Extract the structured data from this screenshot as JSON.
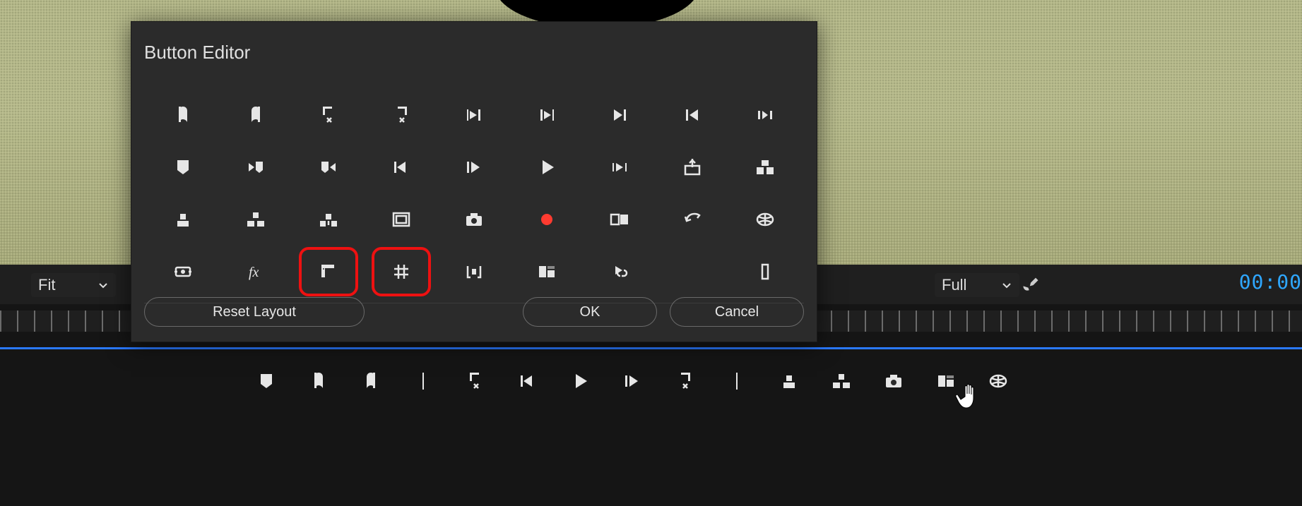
{
  "dialog": {
    "title": "Button Editor",
    "reset_label": "Reset Layout",
    "ok_label": "OK",
    "cancel_label": "Cancel",
    "icons": [
      [
        "mark-in",
        "mark-out",
        "go-to-in",
        "go-to-out",
        "step-back-in",
        "step-forward-out",
        "step-to-next",
        "go-to-previous",
        "play-around"
      ],
      [
        "add-marker",
        "next-marker",
        "prev-marker",
        "step-back-1-frame",
        "step-forward-1-frame",
        "play",
        "play-in-to-out",
        "export-frame",
        "multicam-view"
      ],
      [
        "lift",
        "extract",
        "insert",
        "safe-margins",
        "snapshot",
        "record",
        "comparison-view",
        "undo",
        "vr-video"
      ],
      [
        "proxy-toggle",
        "fx",
        "ruler",
        "grid-overlay",
        "markers-brackets",
        "trim-forward",
        "link-selection",
        "spacer",
        "transparency-grid"
      ]
    ],
    "highlighted": [
      "ruler",
      "grid-overlay"
    ]
  },
  "strip": {
    "fit_label": "Fit",
    "full_label": "Full",
    "timecode": "00:00"
  },
  "transport_icons": [
    "add-marker",
    "mark-in",
    "mark-out",
    "divider",
    "go-to-in",
    "step-back",
    "play",
    "step-forward",
    "go-to-out",
    "divider",
    "lift",
    "extract",
    "snapshot",
    "trim-forward",
    "vr-video"
  ]
}
